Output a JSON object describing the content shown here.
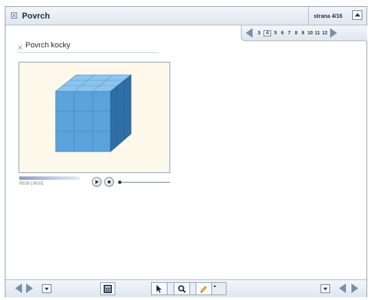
{
  "header": {
    "title": "Povrch",
    "page_status": "strana 4/16"
  },
  "pager": {
    "pages": [
      "3",
      "4",
      "5",
      "6",
      "7",
      "8",
      "9",
      "10",
      "11",
      "12"
    ],
    "active_page": "4"
  },
  "content": {
    "subtitle": "Povrch kocky"
  },
  "video": {
    "time": "00:00 | 00:01",
    "cube_color": "#5aa3dc",
    "background_color": "#fdf8ea"
  },
  "toolbar": {
    "icons": [
      "calculator-icon",
      "cursor-arrow-icon",
      "zoom-icon",
      "pen-icon"
    ]
  }
}
